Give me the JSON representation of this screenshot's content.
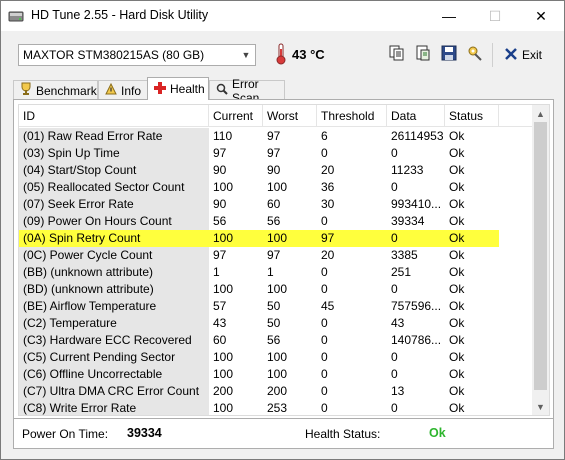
{
  "window": {
    "title": "HD Tune 2.55 - Hard Disk Utility",
    "minimize_glyph": "—",
    "maximize_glyph": "☐",
    "close_glyph": "✕"
  },
  "toolbar": {
    "drive": "MAXTOR  STM380215AS (80 GB)",
    "temperature": "43 °C",
    "exit_label": "Exit",
    "icons": [
      "copy-icon",
      "copy-page-icon",
      "save-icon",
      "options-icon",
      "exit-icon"
    ]
  },
  "tabs": [
    {
      "label": "Benchmark",
      "icon": "benchmark-icon"
    },
    {
      "label": "Info",
      "icon": "info-icon"
    },
    {
      "label": "Health",
      "icon": "health-icon",
      "active": true
    },
    {
      "label": "Error Scan",
      "icon": "search-icon"
    }
  ],
  "health": {
    "columns": [
      "ID",
      "Current",
      "Worst",
      "Threshold",
      "Data",
      "Status"
    ],
    "rows": [
      {
        "id": "(01) Raw Read Error Rate",
        "current": "110",
        "worst": "97",
        "threshold": "6",
        "data": "26114953",
        "status": "Ok"
      },
      {
        "id": "(03) Spin Up Time",
        "current": "97",
        "worst": "97",
        "threshold": "0",
        "data": "0",
        "status": "Ok"
      },
      {
        "id": "(04) Start/Stop Count",
        "current": "90",
        "worst": "90",
        "threshold": "20",
        "data": "11233",
        "status": "Ok"
      },
      {
        "id": "(05) Reallocated Sector Count",
        "current": "100",
        "worst": "100",
        "threshold": "36",
        "data": "0",
        "status": "Ok"
      },
      {
        "id": "(07) Seek Error Rate",
        "current": "90",
        "worst": "60",
        "threshold": "30",
        "data": "993410...",
        "status": "Ok"
      },
      {
        "id": "(09) Power On Hours Count",
        "current": "56",
        "worst": "56",
        "threshold": "0",
        "data": "39334",
        "status": "Ok"
      },
      {
        "id": "(0A) Spin Retry Count",
        "current": "100",
        "worst": "100",
        "threshold": "97",
        "data": "0",
        "status": "Ok",
        "highlight": true
      },
      {
        "id": "(0C) Power Cycle Count",
        "current": "97",
        "worst": "97",
        "threshold": "20",
        "data": "3385",
        "status": "Ok"
      },
      {
        "id": "(BB) (unknown attribute)",
        "current": "1",
        "worst": "1",
        "threshold": "0",
        "data": "251",
        "status": "Ok"
      },
      {
        "id": "(BD) (unknown attribute)",
        "current": "100",
        "worst": "100",
        "threshold": "0",
        "data": "0",
        "status": "Ok"
      },
      {
        "id": "(BE) Airflow Temperature",
        "current": "57",
        "worst": "50",
        "threshold": "45",
        "data": "757596...",
        "status": "Ok"
      },
      {
        "id": "(C2) Temperature",
        "current": "43",
        "worst": "50",
        "threshold": "0",
        "data": "43",
        "status": "Ok"
      },
      {
        "id": "(C3) Hardware ECC Recovered",
        "current": "60",
        "worst": "56",
        "threshold": "0",
        "data": "140786...",
        "status": "Ok"
      },
      {
        "id": "(C5) Current Pending Sector",
        "current": "100",
        "worst": "100",
        "threshold": "0",
        "data": "0",
        "status": "Ok"
      },
      {
        "id": "(C6) Offline Uncorrectable",
        "current": "100",
        "worst": "100",
        "threshold": "0",
        "data": "0",
        "status": "Ok"
      },
      {
        "id": "(C7) Ultra DMA CRC Error Count",
        "current": "200",
        "worst": "200",
        "threshold": "0",
        "data": "13",
        "status": "Ok"
      },
      {
        "id": "(C8) Write Error Rate",
        "current": "100",
        "worst": "253",
        "threshold": "0",
        "data": "0",
        "status": "Ok"
      }
    ]
  },
  "status": {
    "power_on_label": "Power On Time:",
    "power_on_value": "39334",
    "health_label": "Health Status:",
    "health_value": "Ok"
  },
  "colors": {
    "highlight_row": "#ffff3d",
    "health_ok": "#2db52d",
    "temperature_icon": "#d83a3a"
  }
}
